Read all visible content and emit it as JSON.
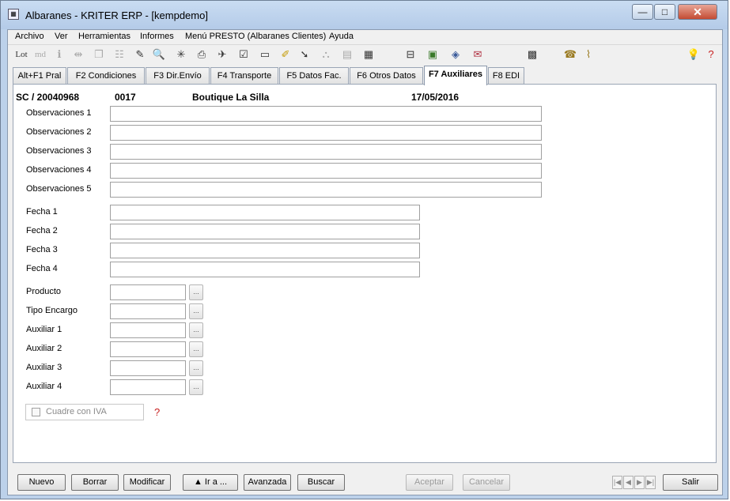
{
  "window": {
    "title": "Albaranes - KRITER ERP -  [kempdemo]",
    "minimize_glyph": "—",
    "maximize_glyph": "□",
    "close_glyph": "✕"
  },
  "menu": [
    "Archivo",
    "Ver",
    "Herramientas",
    "Informes",
    "Menú PRESTO (Albaranes Clientes)",
    "Ayuda"
  ],
  "toolbar": {
    "lot_label": "Lot",
    "md_label": "md",
    "icons": [
      "info-icon",
      "merge-icon",
      "copy-icon",
      "tree-icon",
      "edit-icon",
      "preview-icon",
      "asterisk-icon",
      "print-icon",
      "pin-icon",
      "checklist-icon",
      "rectangle-icon",
      "marker-icon",
      "arrow-icon",
      "hierarchy-icon",
      "grid-icon",
      "table-icon",
      "structure-icon",
      "image-icon",
      "disc-icon",
      "label-icon",
      "calculator-icon",
      "phone-icon",
      "paperclip-icon",
      "lightbulb-icon",
      "help-icon"
    ]
  },
  "tabs": [
    "Alt+F1 Pral",
    "F2 Condiciones",
    "F3 Dir.Envío",
    "F4 Transporte",
    "F5 Datos Fac.",
    "F6 Otros Datos",
    "F7 Auxiliares",
    "F8 EDI"
  ],
  "active_tab": "F7 Auxiliares",
  "header": {
    "doc": "SC / 20040968",
    "code": "0017",
    "client": "Boutique La Silla",
    "date": "17/05/2016"
  },
  "observaciones": [
    {
      "label": "Observaciones 1",
      "value": ""
    },
    {
      "label": "Observaciones 2",
      "value": ""
    },
    {
      "label": "Observaciones 3",
      "value": ""
    },
    {
      "label": "Observaciones 4",
      "value": ""
    },
    {
      "label": "Observaciones 5",
      "value": ""
    }
  ],
  "fechas": [
    {
      "label": "Fecha 1",
      "value": ""
    },
    {
      "label": "Fecha 2",
      "value": ""
    },
    {
      "label": "Fecha 3",
      "value": ""
    },
    {
      "label": "Fecha 4",
      "value": ""
    }
  ],
  "lookups": [
    {
      "label": "Producto",
      "value": ""
    },
    {
      "label": "Tipo Encargo",
      "value": ""
    },
    {
      "label": "Auxiliar 1",
      "value": ""
    },
    {
      "label": "Auxiliar 2",
      "value": ""
    },
    {
      "label": "Auxiliar 3",
      "value": ""
    },
    {
      "label": "Auxiliar 4",
      "value": ""
    }
  ],
  "ellipsis": "...",
  "checkbox": {
    "label": "Cuadre con IVA",
    "checked": false
  },
  "buttons": {
    "nuevo": "Nuevo",
    "borrar": "Borrar",
    "modificar": "Modificar",
    "ira": "▲ Ir a ...",
    "avanzada": "Avanzada",
    "buscar": "Buscar",
    "aceptar": "Aceptar",
    "cancelar": "Cancelar",
    "salir": "Salir"
  },
  "nav": {
    "first": "|◀",
    "prev": "◀",
    "next": "▶",
    "last": "▶|"
  }
}
